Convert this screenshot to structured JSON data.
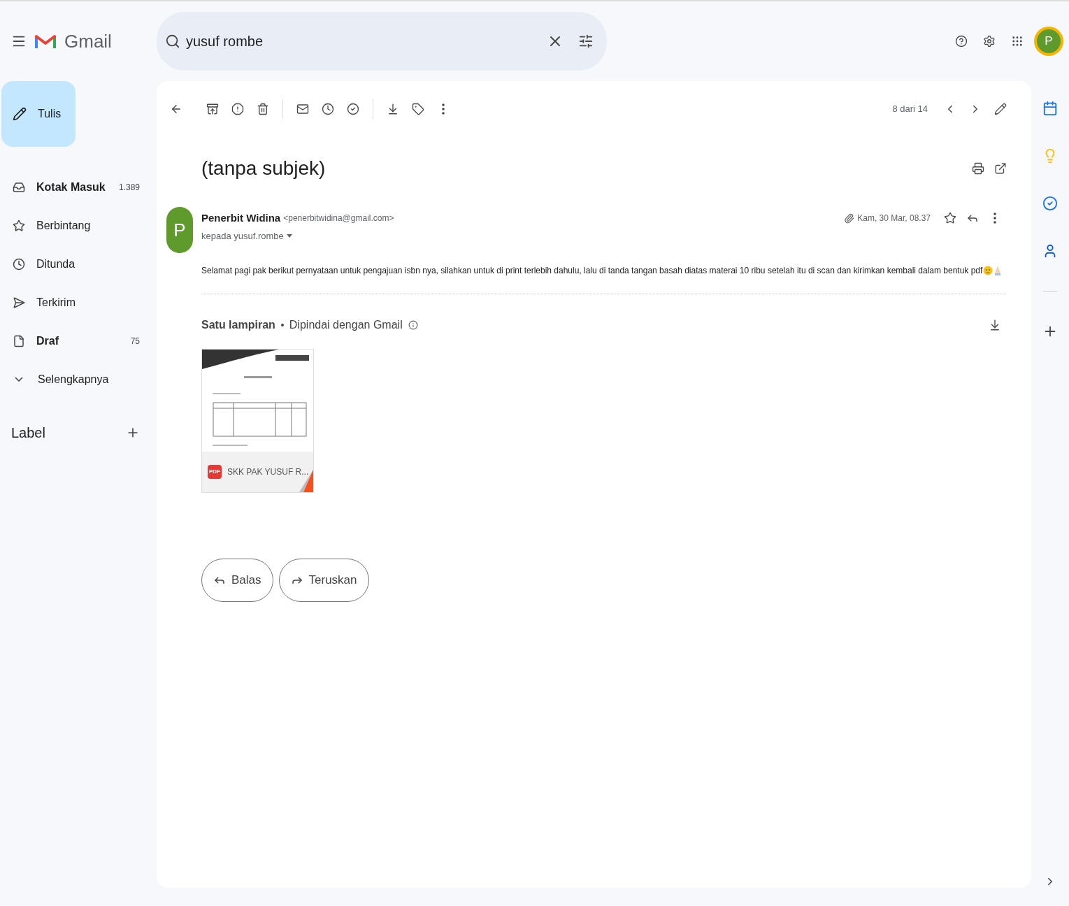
{
  "app": {
    "name": "Gmail"
  },
  "search": {
    "value": "yusuf rombe"
  },
  "compose": {
    "label": "Tulis"
  },
  "nav": [
    {
      "label": "Kotak Masuk",
      "count": "1.389",
      "bold": true
    },
    {
      "label": "Berbintang",
      "bold": false
    },
    {
      "label": "Ditunda",
      "bold": false
    },
    {
      "label": "Terkirim",
      "bold": false
    },
    {
      "label": "Draf",
      "count": "75",
      "bold": true
    },
    {
      "label": "Selengkapnya",
      "bold": false
    }
  ],
  "labels": {
    "title": "Label"
  },
  "account": {
    "initial": "P"
  },
  "pager": {
    "text": "8 dari 14"
  },
  "message": {
    "subject": "(tanpa subjek)",
    "sender_initial": "P",
    "sender_name": "Penerbit Widina",
    "sender_email": "<penerbitwidina@gmail.com>",
    "recipient": "kepada yusuf.rombe",
    "date": "Kam, 30 Mar, 08.37",
    "body": "Selamat pagi pak berikut pernyataan untuk pengajuan isbn nya, silahkan untuk di print terlebih dahulu, lalu di tanda tangan basah diatas materai 10 ribu setelah itu di scan dan kirimkan kembali dalam bentuk pdf"
  },
  "attachments": {
    "title": "Satu lampiran",
    "scanned": "Dipindai dengan Gmail",
    "files": [
      {
        "badge": "PDF",
        "name": "SKK PAK YUSUF R..."
      }
    ]
  },
  "actions": [
    {
      "label": "Balas",
      "kind": "reply"
    },
    {
      "label": "Teruskan",
      "kind": "forward"
    }
  ]
}
